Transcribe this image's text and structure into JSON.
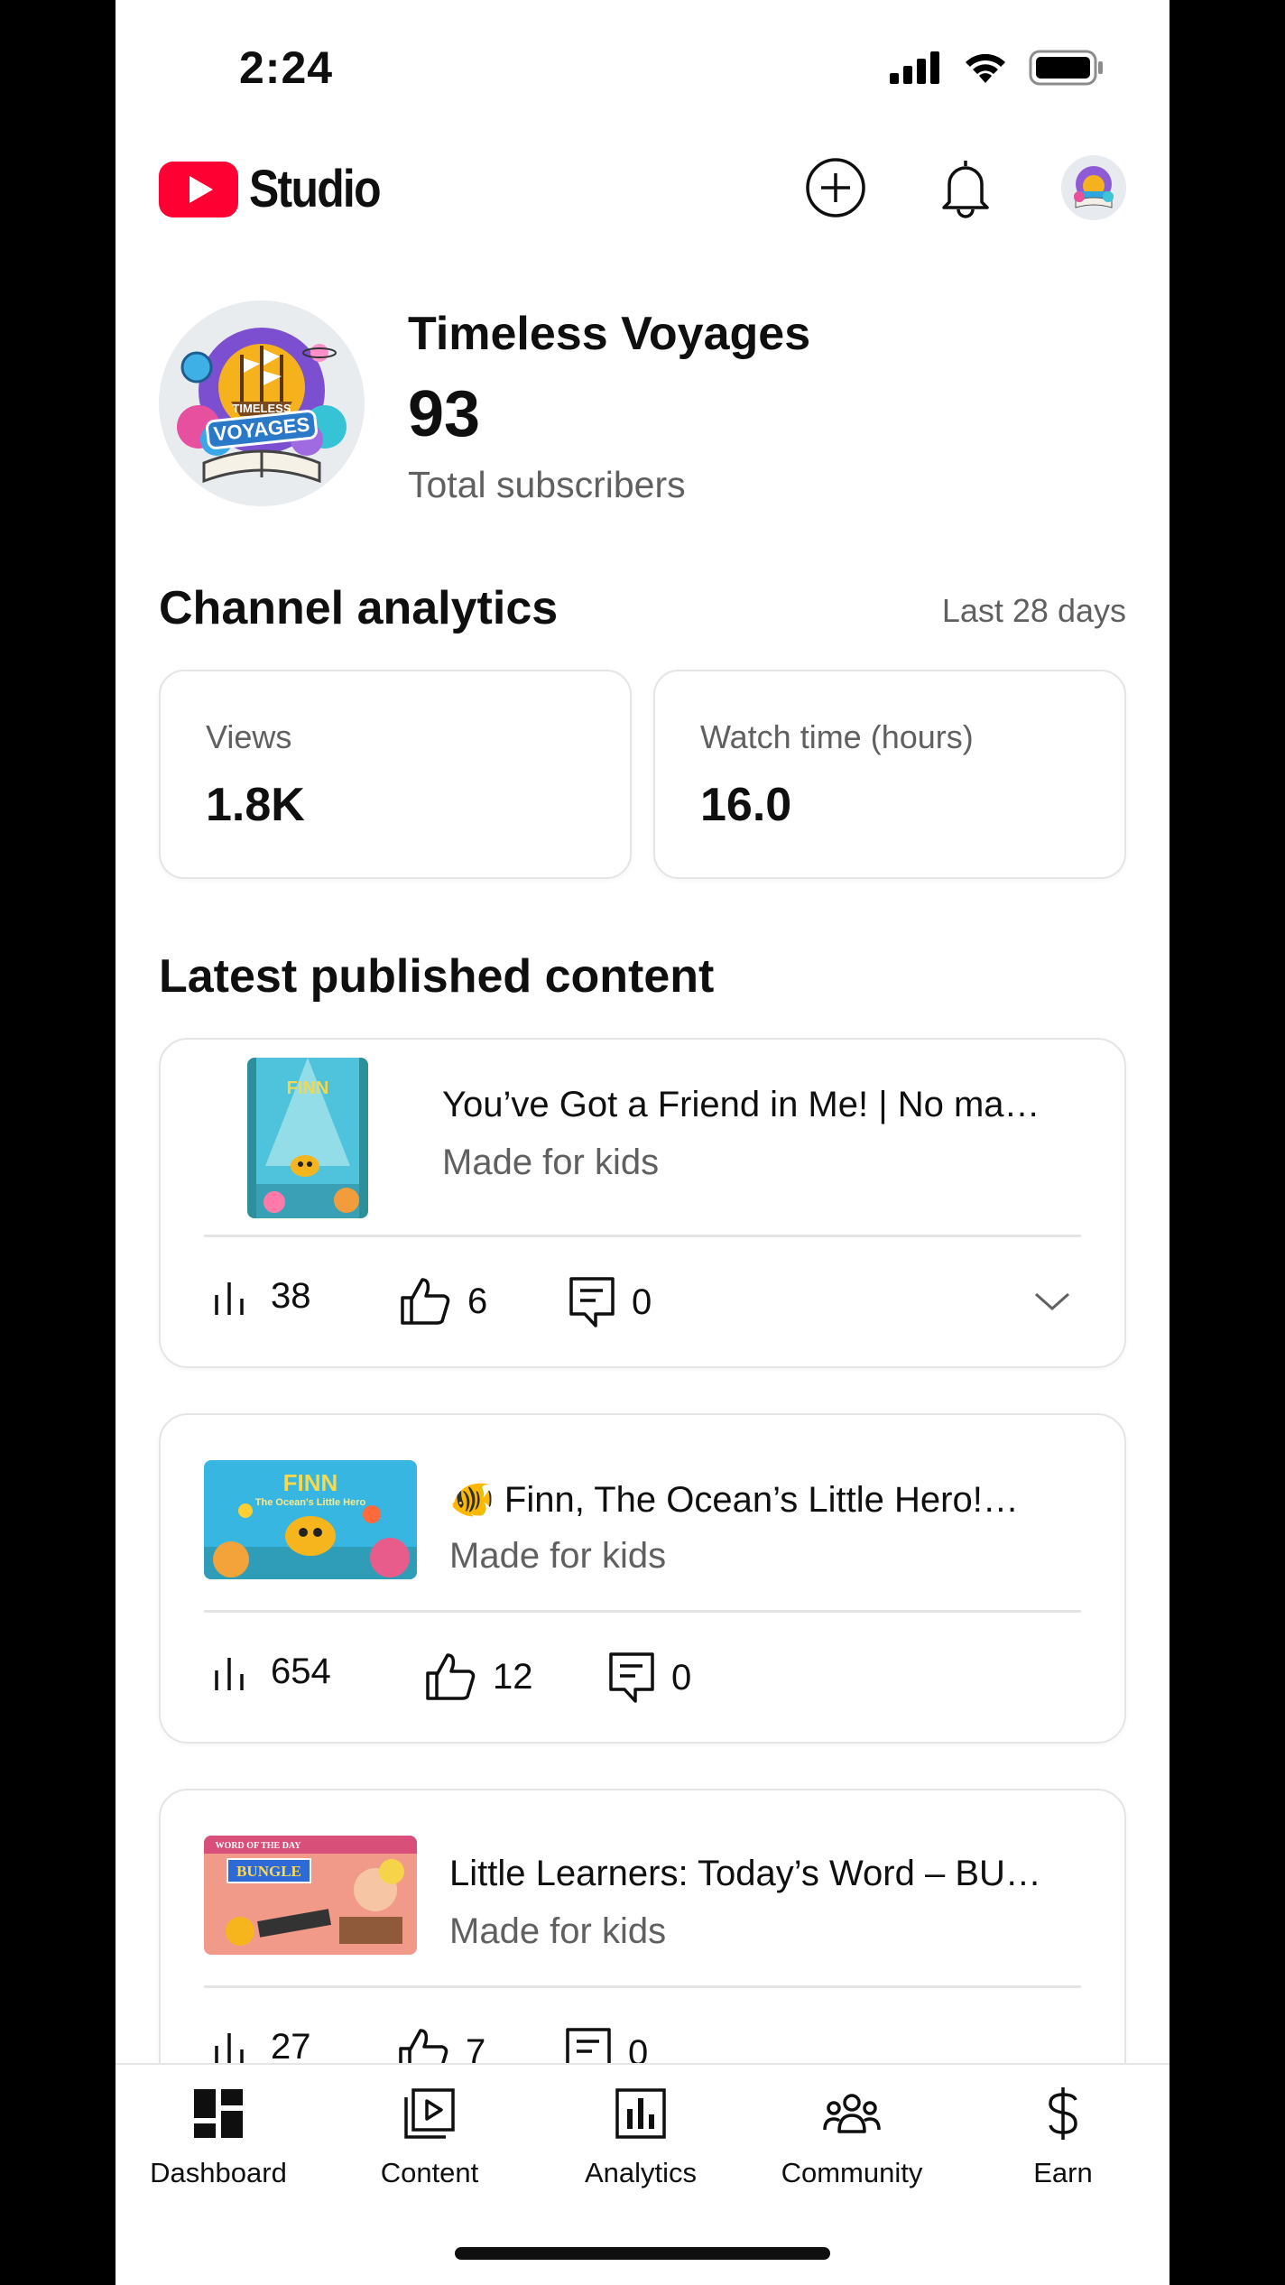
{
  "status_bar": {
    "time": "2:24"
  },
  "header": {
    "app_name": "Studio"
  },
  "channel": {
    "name": "Timeless Voyages",
    "subscribers": "93",
    "subscribers_label": "Total subscribers",
    "avatar_text_top": "TIMELESS",
    "avatar_text_bottom": "VOYAGES"
  },
  "analytics": {
    "title": "Channel analytics",
    "period": "Last 28 days",
    "metrics": [
      {
        "label": "Views",
        "value": "1.8K"
      },
      {
        "label": "Watch time (hours)",
        "value": "16.0"
      }
    ]
  },
  "latest": {
    "title": "Latest published content",
    "videos": [
      {
        "title": "You’ve Got a Friend in Me! | No ma…",
        "status": "Made for kids",
        "views": "38",
        "likes": "6",
        "comments": "0",
        "thumb_text": "FINN"
      },
      {
        "title": "🐠 Finn, The Ocean’s Little Hero!…",
        "status": "Made for kids",
        "views": "654",
        "likes": "12",
        "comments": "0",
        "thumb_text": "FINN",
        "thumb_subtext": "The Ocean's Little Hero"
      },
      {
        "title": "Little Learners: Today’s Word – BU…",
        "status": "Made for kids",
        "views": "27",
        "likes": "7",
        "comments": "0",
        "thumb_text": "BUNGLE",
        "thumb_subtext": "WORD OF THE DAY"
      }
    ]
  },
  "nav": {
    "items": [
      {
        "label": "Dashboard",
        "icon": "dashboard-icon"
      },
      {
        "label": "Content",
        "icon": "content-icon"
      },
      {
        "label": "Analytics",
        "icon": "analytics-icon"
      },
      {
        "label": "Community",
        "icon": "community-icon"
      },
      {
        "label": "Earn",
        "icon": "dollar-icon"
      }
    ]
  },
  "colors": {
    "brand_red": "#ff0033",
    "text": "#0f0f0f",
    "secondary": "#606060",
    "border": "#e5e5e5"
  }
}
